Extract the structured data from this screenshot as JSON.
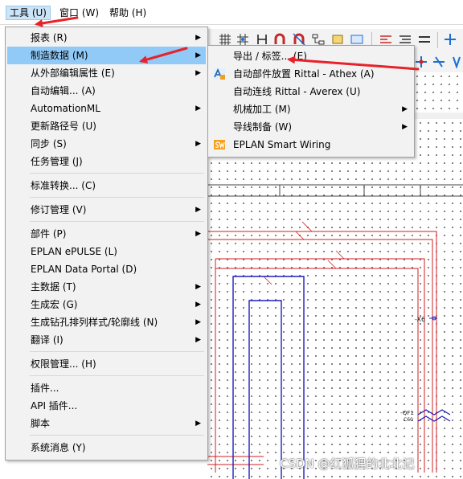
{
  "menubar": {
    "tools": "工具 (U)",
    "window": "窗口 (W)",
    "help": "帮助 (H)"
  },
  "menu": {
    "items": [
      {
        "label": "报表 (R)",
        "submenu": true
      },
      {
        "label": "制造数据 (M)",
        "submenu": true,
        "highlighted": true
      },
      {
        "label": "从外部编辑属性 (E)",
        "submenu": true
      },
      {
        "label": "自动编辑... (A)",
        "submenu": false
      },
      {
        "label": "AutomationML",
        "submenu": true
      },
      {
        "label": "更新路径号 (U)",
        "submenu": false
      },
      {
        "label": "同步 (S)",
        "submenu": true
      },
      {
        "label": "任务管理 (J)",
        "submenu": false
      },
      {
        "label": "标准转换... (C)",
        "submenu": false
      },
      {
        "label": "修订管理 (V)",
        "submenu": true
      },
      {
        "label": "部件 (P)",
        "submenu": true
      },
      {
        "label": "EPLAN ePULSE (L)",
        "submenu": false
      },
      {
        "label": "EPLAN Data Portal (D)",
        "submenu": false
      },
      {
        "label": "主数据 (T)",
        "submenu": true
      },
      {
        "label": "生成宏 (G)",
        "submenu": true
      },
      {
        "label": "生成钻孔排列样式/轮廓线 (N)",
        "submenu": true
      },
      {
        "label": "翻译 (I)",
        "submenu": true
      },
      {
        "label": "权限管理... (H)",
        "submenu": false
      },
      {
        "label": "插件...",
        "submenu": false
      },
      {
        "label": "API 插件...",
        "submenu": false
      },
      {
        "label": "脚本",
        "submenu": true
      },
      {
        "label": "系统消息 (Y)",
        "submenu": false
      }
    ]
  },
  "submenu": {
    "items": [
      {
        "label": "导出 / 标签... (E)",
        "submenu": false,
        "icon": ""
      },
      {
        "label": "自动部件放置 Rittal - Athex (A)",
        "submenu": false,
        "icon": "rittal-athex-icon"
      },
      {
        "label": "自动连线 Rittal - Averex (U)",
        "submenu": false,
        "icon": ""
      },
      {
        "label": "机械加工 (M)",
        "submenu": true,
        "icon": ""
      },
      {
        "label": "导线制备 (W)",
        "submenu": true,
        "icon": ""
      },
      {
        "label": "EPLAN Smart Wiring",
        "submenu": false,
        "icon": "smart-wiring-icon"
      }
    ]
  },
  "canvas": {
    "labels": [
      "-X6",
      "-QF1",
      "C60"
    ]
  },
  "watermark": "CSDN @红狐狸的北北记",
  "colors": {
    "highlight": "#91c9f7",
    "menu_bg": "#f2f2f2",
    "arrow": "#e8222a",
    "wire_red": "#d21e1e",
    "wire_blue": "#1d1dbf"
  }
}
